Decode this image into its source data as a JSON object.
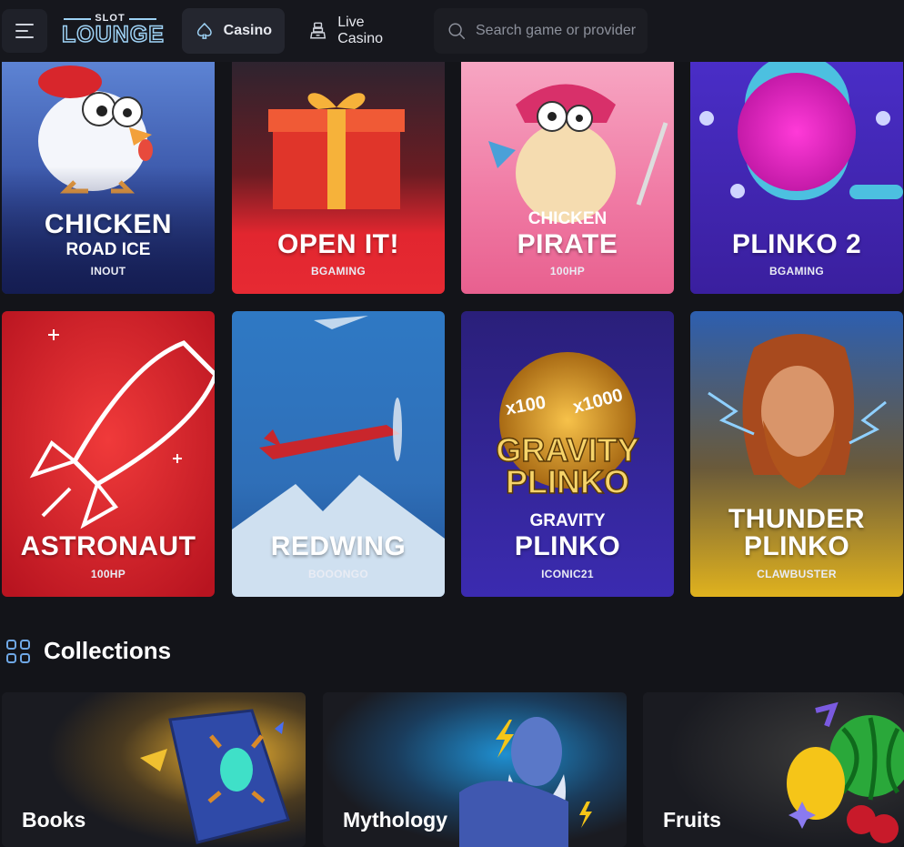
{
  "header": {
    "logo_top": "SLOT",
    "logo_main": "LOUNGE",
    "nav": [
      {
        "label": "Casino",
        "icon": "spade-icon",
        "active": true
      },
      {
        "label": "Live Casino",
        "icon": "dealer-icon",
        "active": false
      }
    ],
    "search_placeholder": "Search game or provider"
  },
  "games": [
    {
      "title": "CHICKEN",
      "subtitle": "ROAD ICE",
      "provider": "INOUT"
    },
    {
      "title": "OPEN IT!",
      "subtitle": "",
      "provider": "BGAMING"
    },
    {
      "title_small": "CHICKEN",
      "title": "PIRATE",
      "provider": "100HP"
    },
    {
      "title": "PLINKO 2",
      "provider": "BGAMING"
    },
    {
      "title": "ASTRONAUT",
      "provider": "100HP"
    },
    {
      "title": "REDWING",
      "provider": "BOOONGO"
    },
    {
      "art_line1": "GRAVITY",
      "art_line2": "PLINKO",
      "art_x1": "x100",
      "art_x2": "x1000",
      "title_small": "GRAVITY",
      "title": "PLINKO",
      "provider": "ICONIC21"
    },
    {
      "title": "THUNDER",
      "subtitle": "PLINKO",
      "provider": "CLAWBUSTER"
    }
  ],
  "collections_section": {
    "title": "Collections",
    "icon": "grid-icon",
    "items": [
      {
        "label": "Books"
      },
      {
        "label": "Mythology"
      },
      {
        "label": "Fruits"
      }
    ]
  },
  "colors": {
    "background": "#131419",
    "topbar": "#16171d",
    "accent_blue": "#9ed2f5"
  }
}
